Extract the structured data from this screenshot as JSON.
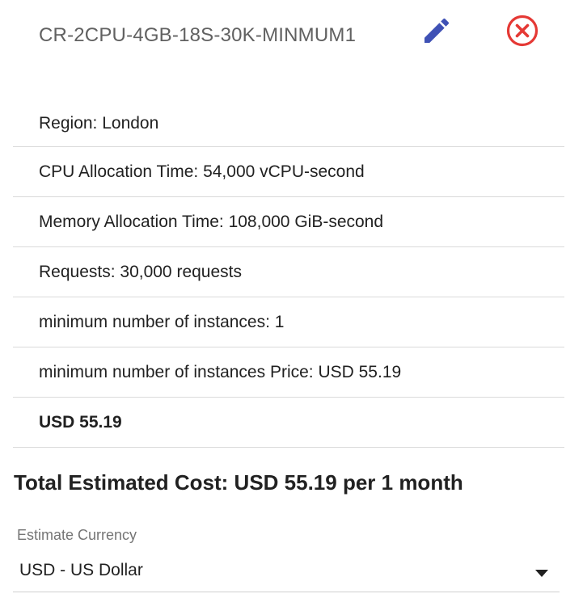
{
  "item": {
    "title": "CR-2CPU-4GB-18S-30K-MINMUM1",
    "edit_icon": "pencil-icon",
    "remove_icon": "close-circle-icon",
    "edit_color": "#3f51b5",
    "remove_color": "#e53935"
  },
  "details": [
    "Region: London",
    "CPU Allocation Time: 54,000 vCPU-second",
    "Memory Allocation Time: 108,000 GiB-second",
    "Requests: 30,000 requests",
    "minimum number of instances: 1",
    "minimum number of instances Price: USD 55.19"
  ],
  "item_total": "USD 55.19",
  "total_estimated_cost": "Total Estimated Cost: USD 55.19 per 1 month",
  "currency": {
    "label": "Estimate Currency",
    "selected": "USD - US Dollar"
  }
}
